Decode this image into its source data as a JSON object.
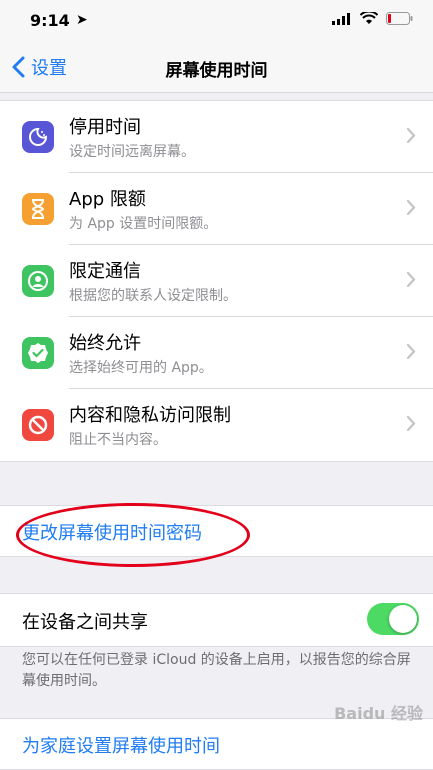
{
  "status": {
    "time": "9:14"
  },
  "nav": {
    "back_label": "设置",
    "title": "屏幕使用时间"
  },
  "items": [
    {
      "title": "停用时间",
      "subtitle": "设定时间远离屏幕。",
      "icon": "downtime-icon",
      "color": "#5856d6"
    },
    {
      "title": "App 限额",
      "subtitle": "为 App 设置时间限额。",
      "icon": "hourglass-icon",
      "color": "#f7a032"
    },
    {
      "title": "限定通信",
      "subtitle": "根据您的联系人设定限制。",
      "icon": "contact-icon",
      "color": "#3ec461"
    },
    {
      "title": "始终允许",
      "subtitle": "选择始终可用的 App。",
      "icon": "checkmark-badge-icon",
      "color": "#3ec461"
    },
    {
      "title": "内容和隐私访问限制",
      "subtitle": "阻止不当内容。",
      "icon": "restricted-icon",
      "color": "#f0473e"
    }
  ],
  "change_passcode_label": "更改屏幕使用时间密码",
  "share": {
    "label": "在设备之间共享",
    "enabled": true,
    "toggle_color": "#4cd964"
  },
  "share_footer": "您可以在任何已登录 iCloud 的设备上启用，以报告您的综合屏幕使用时间。",
  "family_label": "为家庭设置屏幕使用时间",
  "watermark": "Baidu 经验",
  "accent": "#1f7cf3"
}
